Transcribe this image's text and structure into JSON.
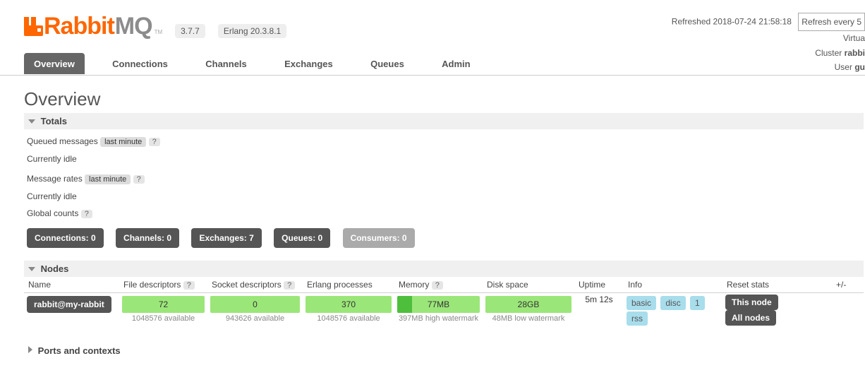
{
  "logo": {
    "rabbit": "Rabbit",
    "mq": "MQ",
    "tm": "TM"
  },
  "version": "3.7.7",
  "erlang": "Erlang 20.3.8.1",
  "status": {
    "refreshed_label": "Refreshed",
    "refreshed_time": "2018-07-24 21:58:18",
    "refresh_setting": "Refresh every 5",
    "virtual": "Virtua",
    "cluster_label": "Cluster",
    "cluster_value": "rabbi",
    "user_label": "User",
    "user_value": "gu"
  },
  "tabs": [
    "Overview",
    "Connections",
    "Channels",
    "Exchanges",
    "Queues",
    "Admin"
  ],
  "page_title": "Overview",
  "sections": {
    "totals": "Totals",
    "nodes": "Nodes",
    "ports": "Ports and contexts"
  },
  "totals": {
    "queued_label": "Queued messages",
    "last_minute": "last minute",
    "help": "?",
    "idle": "Currently idle",
    "msg_rates_label": "Message rates",
    "global_counts": "Global counts"
  },
  "counts": {
    "connections": {
      "label": "Connections:",
      "value": "0"
    },
    "channels": {
      "label": "Channels:",
      "value": "0"
    },
    "exchanges": {
      "label": "Exchanges:",
      "value": "7"
    },
    "queues": {
      "label": "Queues:",
      "value": "0"
    },
    "consumers": {
      "label": "Consumers:",
      "value": "0"
    }
  },
  "nodes_table": {
    "headers": {
      "name": "Name",
      "fd": "File descriptors",
      "sd": "Socket descriptors",
      "ep": "Erlang processes",
      "mem": "Memory",
      "disk": "Disk space",
      "uptime": "Uptime",
      "info": "Info",
      "reset": "Reset stats",
      "tail": "+/-"
    },
    "row": {
      "name": "rabbit@my-rabbit",
      "fd": "72",
      "fd_avail": "1048576 available",
      "sd": "0",
      "sd_avail": "943626 available",
      "ep": "370",
      "ep_avail": "1048576 available",
      "mem": "77MB",
      "mem_sub": "397MB high watermark",
      "disk": "28GB",
      "disk_sub": "48MB low watermark",
      "uptime": "5m 12s",
      "info_badges": [
        "basic",
        "disc",
        "1",
        "rss"
      ],
      "reset_this": "This node",
      "reset_all": "All nodes"
    }
  }
}
